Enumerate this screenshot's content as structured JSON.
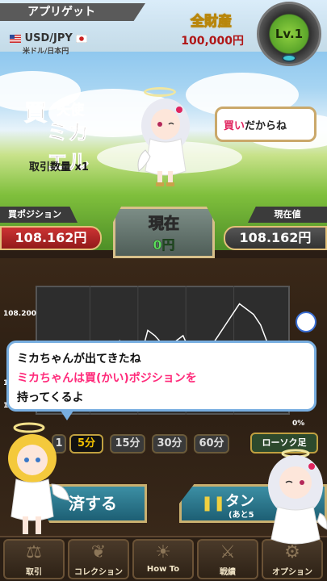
{
  "header": {
    "app_title": "アプリゲット",
    "pair": "USD/JPY",
    "pair_sub": "米ドル/日本円",
    "total_assets_label": "全財産",
    "total_assets_value": "100,000円",
    "level": "Lv.1"
  },
  "character": {
    "logo_kanji_buy": "買",
    "logo_kanji_angel": "天使",
    "logo_name": "ミカエル",
    "trade_qty": "取引数量 x1",
    "speech_red": "買い",
    "speech_rest": "だからね"
  },
  "status": {
    "buy_position_label": "買ポジション",
    "buy_position_value": "108.162円",
    "now_label": "現在",
    "now_value": "0円",
    "current_price_label": "現在値",
    "current_price_value": "108.162円"
  },
  "chart_data": {
    "type": "line",
    "y_tick": "108.200",
    "entry_line": 108.162,
    "values": [
      108.195,
      108.07,
      108.1,
      108.03,
      108.2,
      108.18,
      108.15,
      108.19,
      108.2,
      108.25,
      108.22,
      108.26,
      108.17,
      108.16,
      108.2,
      108.3,
      108.28,
      108.25,
      108.24,
      108.26,
      108.28,
      108.22,
      108.18,
      108.21,
      108.24,
      108.28,
      108.32,
      108.36,
      108.4,
      108.38,
      108.36,
      108.32,
      108.25,
      108.21,
      108.2
    ],
    "y_range": [
      108.0,
      108.45
    ],
    "pct_label": "0%"
  },
  "dialog": {
    "line1": "ミカちゃんが出てきたね",
    "line2": "ミカちゃんは買(かい)ポジションを",
    "line3": "持ってくるよ"
  },
  "timeframes": {
    "partial": "1",
    "items": [
      "5分",
      "15分",
      "30分",
      "60分"
    ],
    "active_index": 0,
    "candle_label": "ローソク足"
  },
  "actions": {
    "settle_label": "決済する",
    "settle_visible": "済する",
    "tank_label": "タンク",
    "tank_visible": "タン",
    "tank_sub": "(あと5"
  },
  "nav": {
    "items": [
      {
        "label": "取引",
        "icon": "scale-icon"
      },
      {
        "label": "コレクション",
        "icon": "wing-icon"
      },
      {
        "label": "How To",
        "icon": "lightbulb-icon"
      },
      {
        "label": "戦績",
        "icon": "swords-icon"
      },
      {
        "label": "オプション",
        "icon": "gear-icon"
      }
    ]
  },
  "colors": {
    "buy_red": "#c33",
    "profit_green": "#5de05d",
    "accent_gold": "#c9b070",
    "speech_pink": "#ff2a7a"
  }
}
